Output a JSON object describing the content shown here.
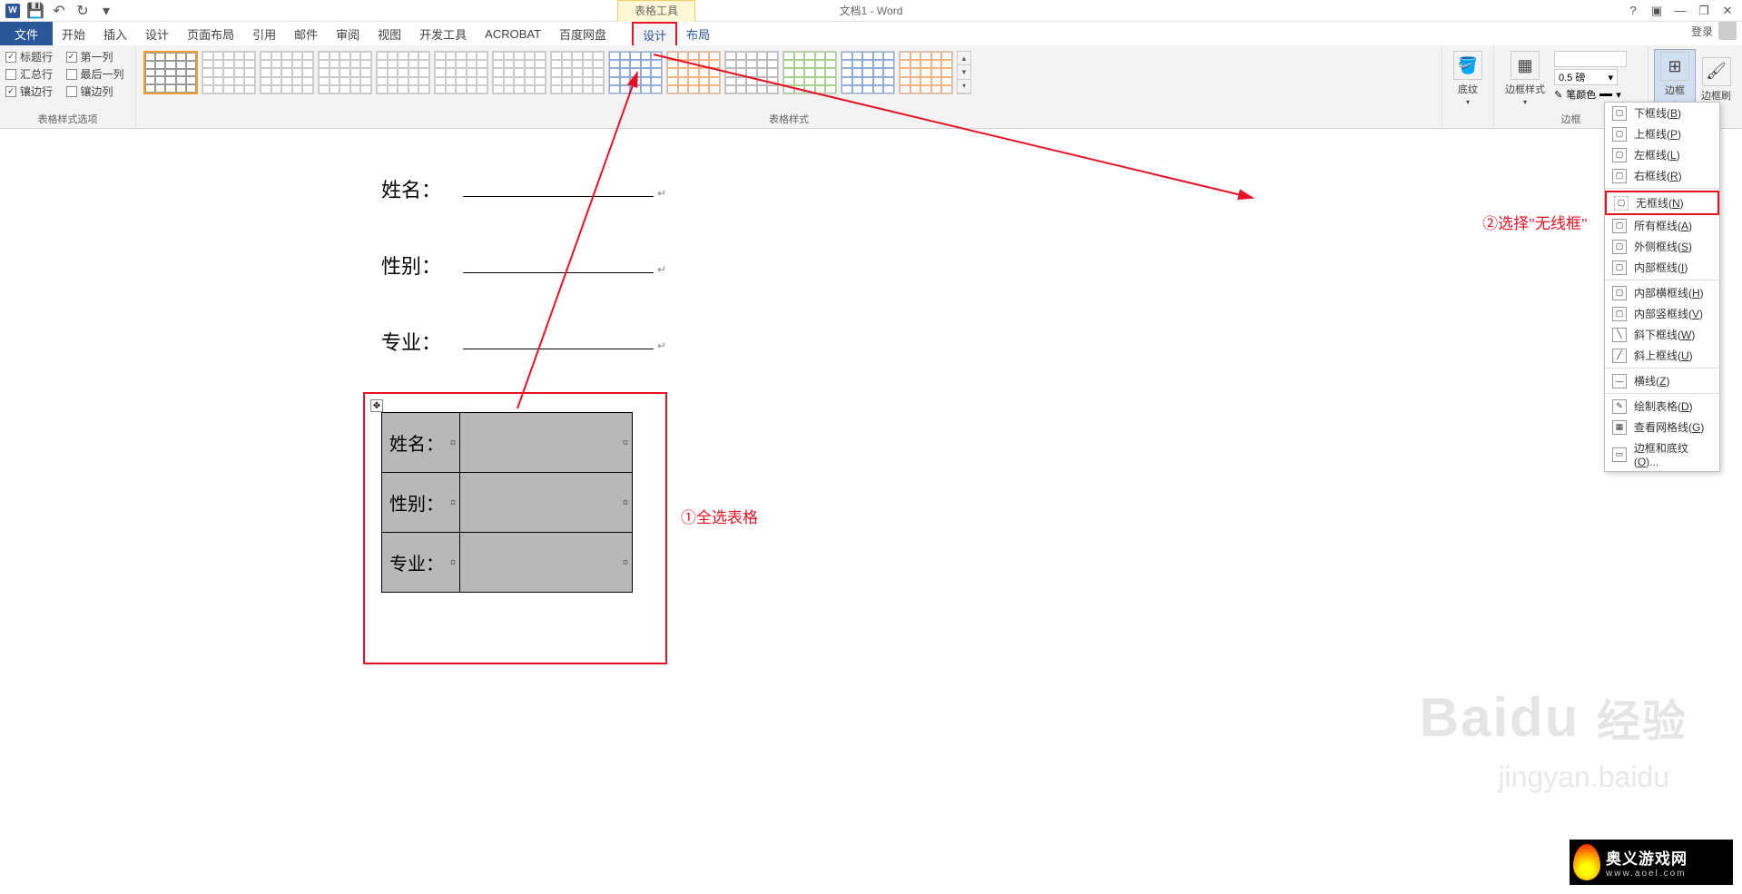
{
  "title": "文档1 - Word",
  "table_tools_label": "表格工具",
  "qat": {
    "save": "保存",
    "undo": "撤销",
    "redo": "重做"
  },
  "win": {
    "help": "?",
    "ribbon_opts": "▣",
    "min": "—",
    "restore": "❐",
    "close": "✕"
  },
  "tabs": {
    "file": "文件",
    "home": "开始",
    "insert": "插入",
    "design": "设计",
    "layout": "页面布局",
    "references": "引用",
    "mailings": "邮件",
    "review": "审阅",
    "view": "视图",
    "developer": "开发工具",
    "acrobat": "ACROBAT",
    "baidu": "百度网盘",
    "table_design": "设计",
    "table_layout": "布局",
    "login": "登录"
  },
  "ribbon": {
    "style_options_label": "表格样式选项",
    "opts": {
      "header_row": "标题行",
      "first_col": "第一列",
      "total_row": "汇总行",
      "last_col": "最后一列",
      "banded_row": "镶边行",
      "banded_col": "镶边列"
    },
    "checked": {
      "header_row": true,
      "first_col": true,
      "total_row": false,
      "last_col": false,
      "banded_row": true,
      "banded_col": false
    },
    "table_styles_label": "表格样式",
    "shading": "底纹",
    "border_styles": "边框样式",
    "pen_weight": "0.5 磅",
    "pen_color": "笔颜色",
    "borders_label": "边框",
    "borders_btn": "边框",
    "border_painter": "边框刷"
  },
  "doc": {
    "fields": [
      "姓名：",
      "性别：",
      "专业："
    ],
    "table_rows": [
      "姓名：",
      "性别：",
      "专业："
    ]
  },
  "annotations": {
    "step1": "①全选表格",
    "step2": "②选择\"无线框\""
  },
  "border_menu": [
    {
      "id": "bottom",
      "label": "下框线",
      "key": "B"
    },
    {
      "id": "top",
      "label": "上框线",
      "key": "P"
    },
    {
      "id": "left",
      "label": "左框线",
      "key": "L"
    },
    {
      "id": "right",
      "label": "右框线",
      "key": "R"
    },
    {
      "id": "sep1",
      "sep": true
    },
    {
      "id": "none",
      "label": "无框线",
      "key": "N",
      "highlight": true
    },
    {
      "id": "all",
      "label": "所有框线",
      "key": "A"
    },
    {
      "id": "outside",
      "label": "外侧框线",
      "key": "S"
    },
    {
      "id": "inside",
      "label": "内部框线",
      "key": "I"
    },
    {
      "id": "sep2",
      "sep": true
    },
    {
      "id": "inside_h",
      "label": "内部横框线",
      "key": "H"
    },
    {
      "id": "inside_v",
      "label": "内部竖框线",
      "key": "V"
    },
    {
      "id": "diag_down",
      "label": "斜下框线",
      "key": "W"
    },
    {
      "id": "diag_up",
      "label": "斜上框线",
      "key": "U"
    },
    {
      "id": "sep3",
      "sep": true
    },
    {
      "id": "hline",
      "label": "横线",
      "key": "Z"
    },
    {
      "id": "sep4",
      "sep": true
    },
    {
      "id": "draw",
      "label": "绘制表格",
      "key": "D"
    },
    {
      "id": "gridlines",
      "label": "查看网格线",
      "key": "G"
    },
    {
      "id": "dialog",
      "label": "边框和底纹",
      "key": "O",
      "ellipsis": true
    }
  ],
  "watermark": {
    "brand": "Baidu",
    "brand_cn": "经验",
    "sub": "jingyan.baidu"
  },
  "site": {
    "name": "奥义游戏网",
    "url": "www.aoel.com"
  }
}
